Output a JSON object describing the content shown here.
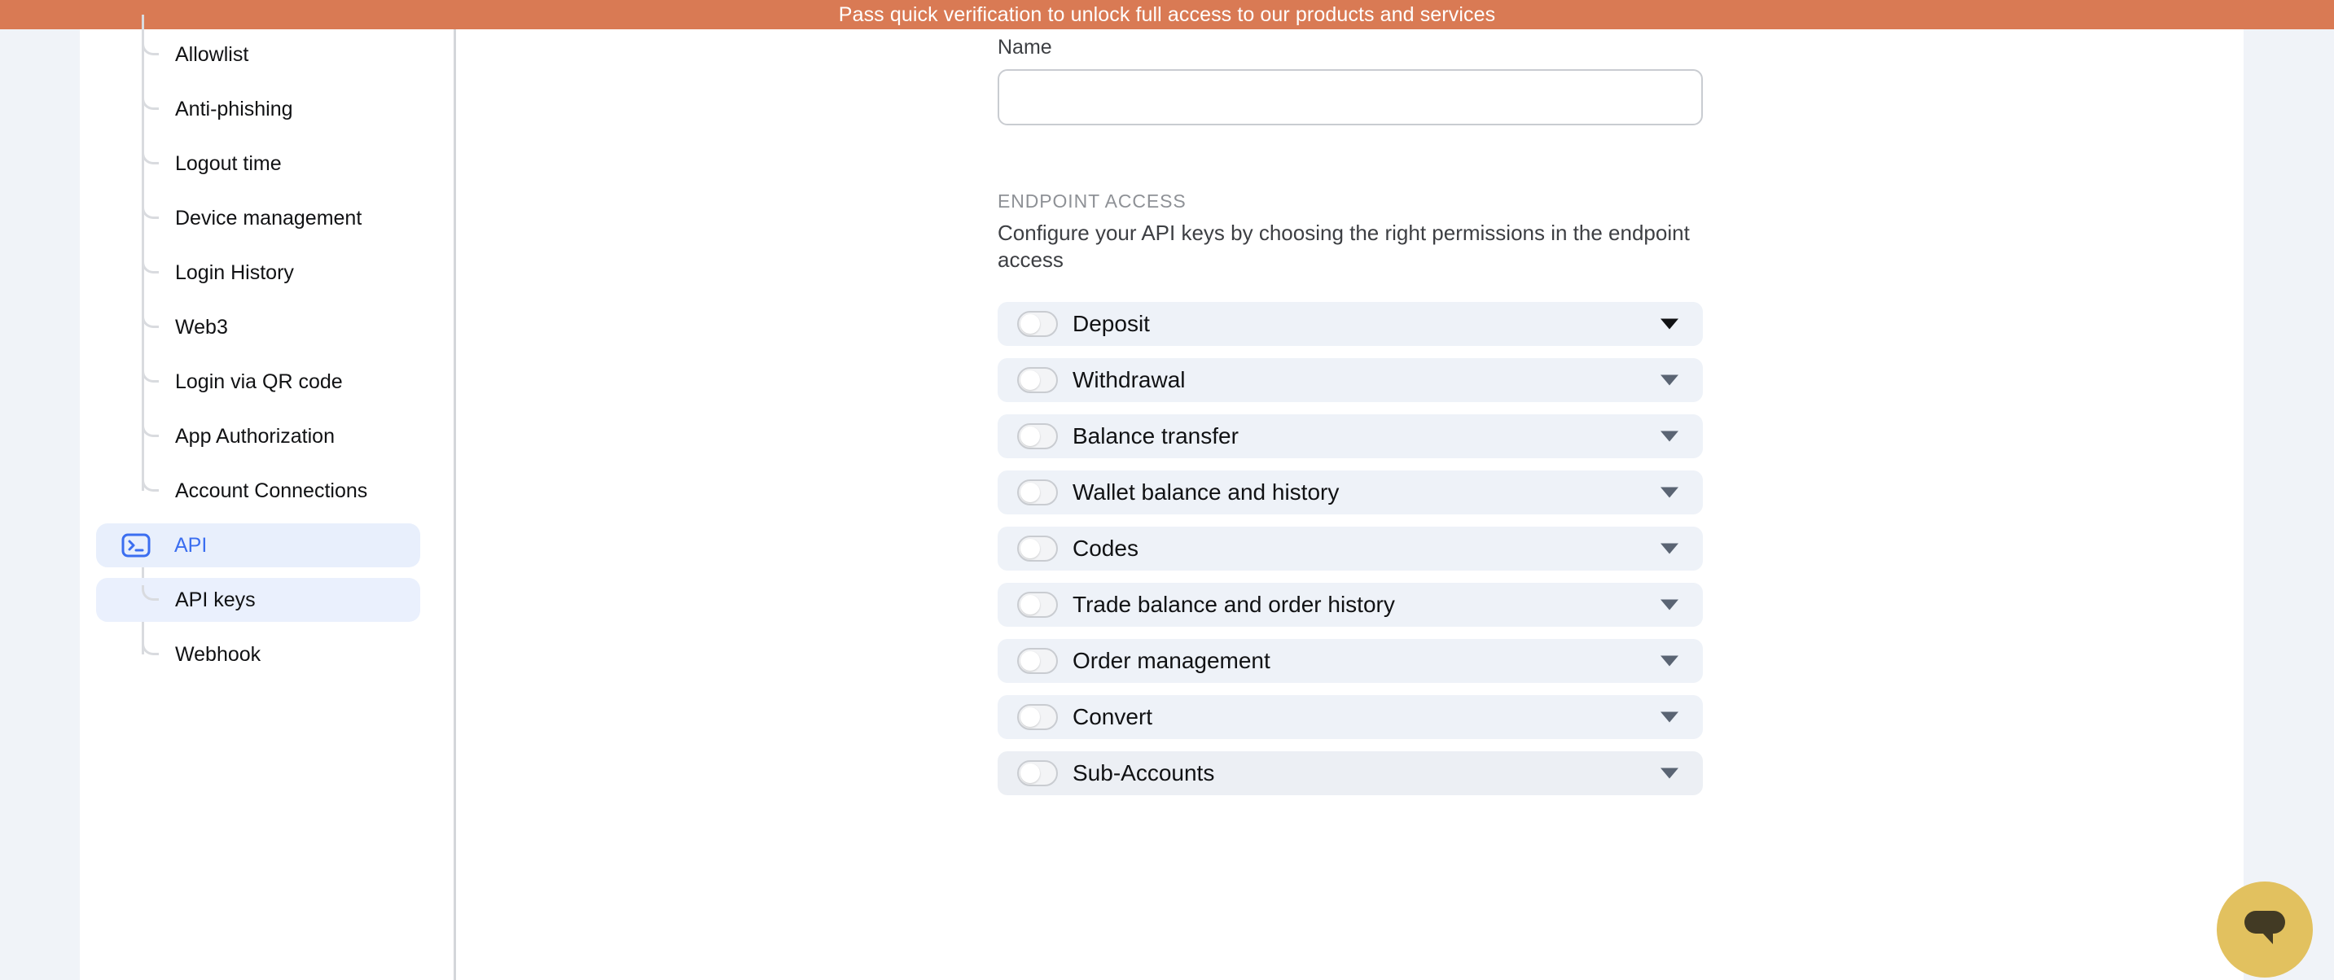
{
  "banner": {
    "text": "Pass quick verification to unlock full access to our products and services",
    "background": "#d97a54",
    "text_color": "#ffffff"
  },
  "sidebar": {
    "items": [
      {
        "label": "Allowlist",
        "type": "child",
        "state": "default"
      },
      {
        "label": "Anti-phishing",
        "type": "child",
        "state": "default"
      },
      {
        "label": "Logout time",
        "type": "child",
        "state": "default"
      },
      {
        "label": "Device management",
        "type": "child",
        "state": "default"
      },
      {
        "label": "Login History",
        "type": "child",
        "state": "default"
      },
      {
        "label": "Web3",
        "type": "child",
        "state": "default"
      },
      {
        "label": "Login via QR code",
        "type": "child",
        "state": "default"
      },
      {
        "label": "App Authorization",
        "type": "child",
        "state": "default"
      },
      {
        "label": "Account Connections",
        "type": "child",
        "state": "default"
      },
      {
        "label": "API",
        "type": "parent",
        "state": "active",
        "icon": "terminal-icon"
      },
      {
        "label": "API keys",
        "type": "child",
        "state": "selected"
      },
      {
        "label": "Webhook",
        "type": "child",
        "state": "default"
      }
    ],
    "active_color": "#3b6ef0",
    "active_background": "#e8effc",
    "selected_background": "#eaf0fd"
  },
  "main": {
    "name_field": {
      "label": "Name",
      "value": "",
      "placeholder": ""
    },
    "endpoint_access": {
      "heading": "ENDPOINT ACCESS",
      "description": "Configure your API keys by choosing the right permissions in the endpoint access",
      "permissions": [
        {
          "label": "Deposit",
          "enabled": false,
          "expanded": false,
          "chevron": "chevron-down-icon",
          "chevron_style": "dark",
          "faded": false
        },
        {
          "label": "Withdrawal",
          "enabled": false,
          "expanded": false,
          "chevron": "chevron-down-icon",
          "chevron_style": "muted",
          "faded": false
        },
        {
          "label": "Balance transfer",
          "enabled": false,
          "expanded": false,
          "chevron": "chevron-down-icon",
          "chevron_style": "muted",
          "faded": false
        },
        {
          "label": "Wallet balance and history",
          "enabled": false,
          "expanded": false,
          "chevron": "chevron-down-icon",
          "chevron_style": "muted",
          "faded": false
        },
        {
          "label": "Codes",
          "enabled": false,
          "expanded": false,
          "chevron": "chevron-down-icon",
          "chevron_style": "muted",
          "faded": false
        },
        {
          "label": "Trade balance and order history",
          "enabled": false,
          "expanded": false,
          "chevron": "chevron-down-icon",
          "chevron_style": "muted",
          "faded": false
        },
        {
          "label": "Order management",
          "enabled": false,
          "expanded": false,
          "chevron": "chevron-down-icon",
          "chevron_style": "muted",
          "faded": false
        },
        {
          "label": "Convert",
          "enabled": false,
          "expanded": false,
          "chevron": "chevron-down-icon",
          "chevron_style": "muted",
          "faded": false
        },
        {
          "label": "Sub-Accounts",
          "enabled": false,
          "expanded": false,
          "chevron": "chevron-down-icon",
          "chevron_style": "muted",
          "faded": true
        }
      ]
    }
  },
  "chat_widget": {
    "icon": "chat-bubble-icon",
    "background": "#e2c15f",
    "icon_color": "#423a24"
  }
}
